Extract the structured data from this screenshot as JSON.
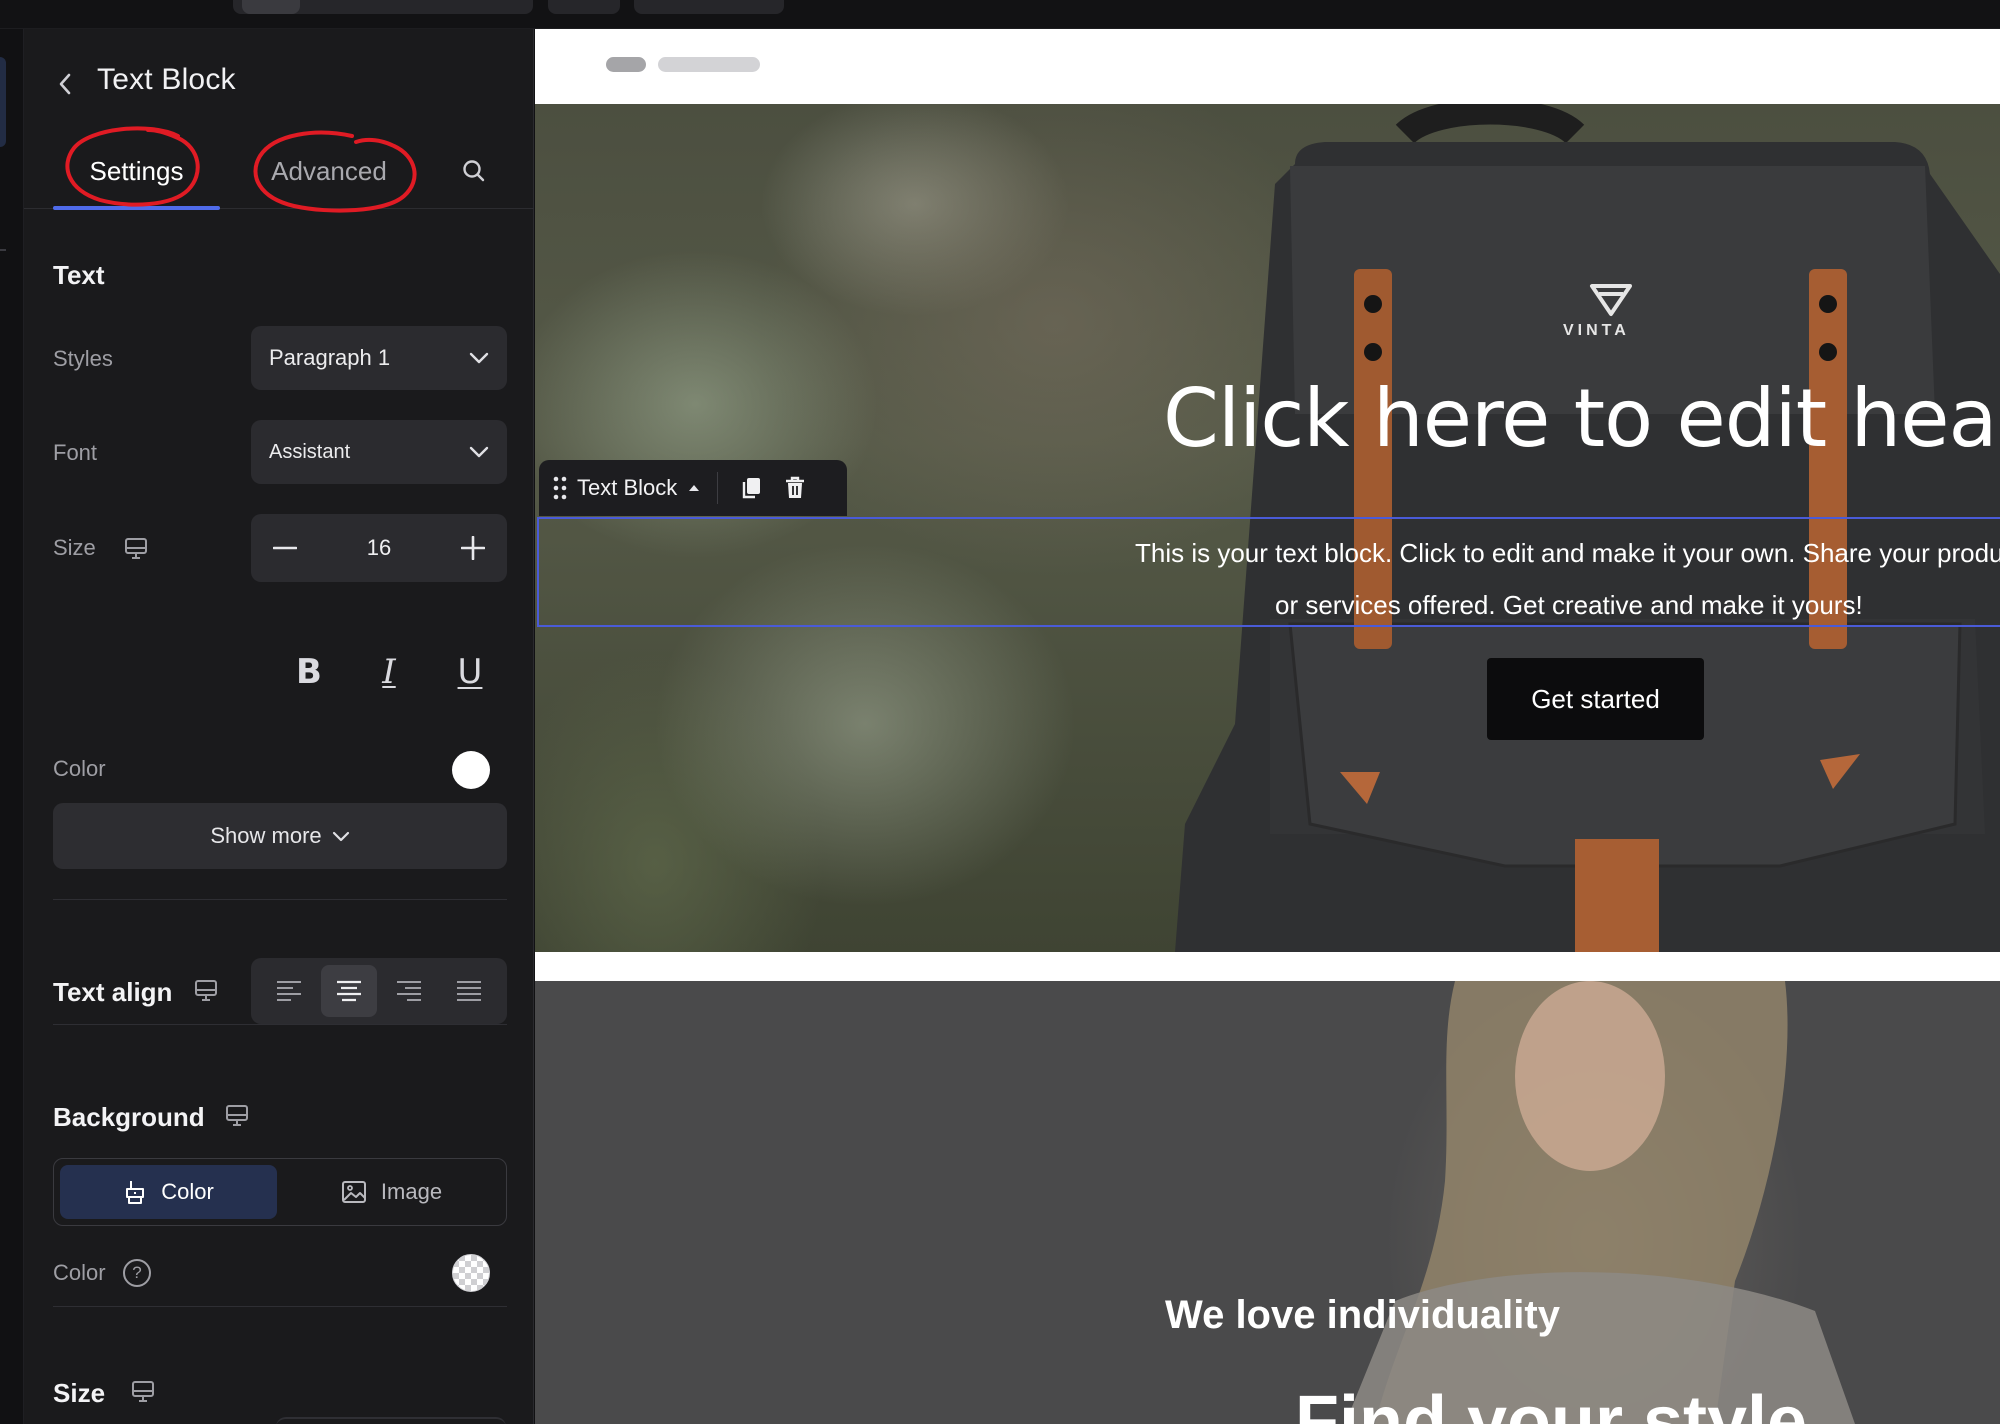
{
  "panel": {
    "title": "Text Block",
    "tabs": [
      {
        "label": "Settings",
        "active": true
      },
      {
        "label": "Advanced",
        "active": false
      }
    ],
    "text_section": {
      "title": "Text",
      "styles_label": "Styles",
      "styles_value": "Paragraph 1",
      "font_label": "Font",
      "font_value": "Assistant",
      "size_label": "Size",
      "size_value": "16",
      "format_buttons": [
        {
          "name": "bold",
          "glyph": "B"
        },
        {
          "name": "italic",
          "glyph": "I"
        },
        {
          "name": "underline",
          "glyph": "U"
        }
      ],
      "color_label": "Color",
      "color_value": "#ffffff",
      "show_more_label": "Show more"
    },
    "text_align": {
      "title": "Text align",
      "options": [
        "left",
        "center",
        "right",
        "justify"
      ],
      "selected": "center"
    },
    "background": {
      "title": "Background",
      "options": [
        {
          "label": "Color",
          "icon": "paint-bucket-icon",
          "active": true
        },
        {
          "label": "Image",
          "icon": "image-icon",
          "active": false
        }
      ],
      "color_label": "Color",
      "color_value": "transparent"
    },
    "size_section": {
      "title": "Size"
    }
  },
  "canvas": {
    "hero": {
      "heading": "Click here to edit heading",
      "body_line1": "This is your text block. Click to edit and make it your own. Share your produc",
      "body_line2": "or services offered. Get creative and make it yours!",
      "cta_label": "Get started",
      "toolbar_label": "Text Block",
      "logo_text": "VINTA"
    },
    "second_section": {
      "subheading": "We love individuality",
      "heading": "Find your style"
    }
  },
  "colors": {
    "accent": "#4f6bea",
    "annotation": "#e01b24",
    "panel_bg": "#1a1a1c",
    "selection": "#4a5bd8"
  }
}
